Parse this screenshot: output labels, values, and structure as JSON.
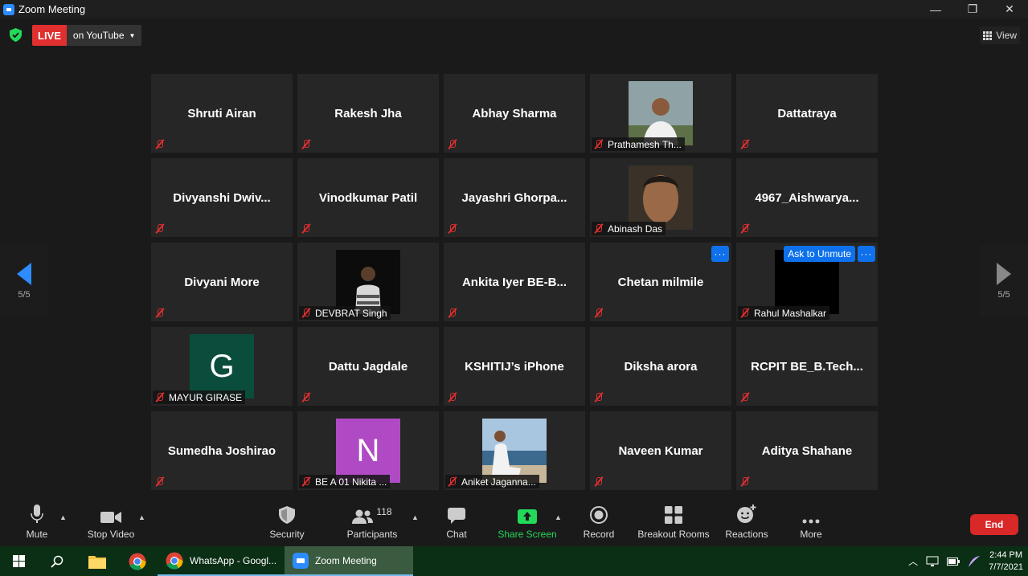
{
  "window": {
    "title": "Zoom Meeting",
    "minimize": "—",
    "restore": "❐",
    "close": "✕"
  },
  "topbar": {
    "live": "LIVE",
    "stream": "on YouTube",
    "view": "View"
  },
  "nav": {
    "page_left": "5/5",
    "page_right": "5/5"
  },
  "tiles": [
    {
      "name": "Shruti Airan",
      "label": "",
      "type": "name"
    },
    {
      "name": "Rakesh Jha",
      "label": "",
      "type": "name"
    },
    {
      "name": "Abhay Sharma",
      "label": "",
      "type": "name"
    },
    {
      "name": "",
      "label": "Prathamesh Th...",
      "type": "photo",
      "photo": "p1"
    },
    {
      "name": "Dattatraya",
      "label": "",
      "type": "name"
    },
    {
      "name": "Divyanshi  Dwiv...",
      "label": "",
      "type": "name"
    },
    {
      "name": "Vinodkumar Patil",
      "label": "",
      "type": "name"
    },
    {
      "name": "Jayashri  Ghorpa...",
      "label": "",
      "type": "name"
    },
    {
      "name": "",
      "label": "Abinash Das",
      "type": "photo",
      "photo": "p2"
    },
    {
      "name": "4967_Aishwarya...",
      "label": "",
      "type": "name"
    },
    {
      "name": "Divyani More",
      "label": "",
      "type": "name"
    },
    {
      "name": "",
      "label": "DEVBRAT Singh",
      "type": "photo",
      "photo": "p3"
    },
    {
      "name": "Ankita  Iyer  BE-B...",
      "label": "",
      "type": "name"
    },
    {
      "name": "Chetan milmile",
      "label": "",
      "type": "name",
      "more": "···"
    },
    {
      "name": "",
      "label": "Rahul Mashalkar",
      "type": "black",
      "more": "···",
      "ask": "Ask to Unmute"
    },
    {
      "name": "",
      "label": "MAYUR GIRASE",
      "type": "letter",
      "letter": "G",
      "color": "#0b4d3c"
    },
    {
      "name": "Dattu Jagdale",
      "label": "",
      "type": "name"
    },
    {
      "name": "KSHITIJ’s iPhone",
      "label": "",
      "type": "name"
    },
    {
      "name": "Diksha arora",
      "label": "",
      "type": "name"
    },
    {
      "name": "RCPIT  BE_B.Tech...",
      "label": "",
      "type": "name"
    },
    {
      "name": "Sumedha Joshirao",
      "label": "",
      "type": "name"
    },
    {
      "name": "",
      "label": "BE A 01 Nikita ...",
      "type": "letter",
      "letter": "N",
      "color": "#b04ac4"
    },
    {
      "name": "",
      "label": "Aniket Jaganna...",
      "type": "photo",
      "photo": "p4"
    },
    {
      "name": "Naveen Kumar",
      "label": "",
      "type": "name"
    },
    {
      "name": "Aditya Shahane",
      "label": "",
      "type": "name"
    }
  ],
  "toolbar": {
    "mute": "Mute",
    "stop_video": "Stop Video",
    "security": "Security",
    "participants": "Participants",
    "participants_count": "118",
    "chat": "Chat",
    "share_screen": "Share Screen",
    "record": "Record",
    "breakout": "Breakout Rooms",
    "reactions": "Reactions",
    "more": "More",
    "end": "End"
  },
  "taskbar": {
    "whatsapp": "WhatsApp - Googl...",
    "zoom": "Zoom Meeting",
    "time": "2:44 PM",
    "date": "7/7/2021"
  },
  "colors": {
    "accent": "#2d8cff",
    "live": "#e02f2f",
    "end": "#d82828",
    "share": "#23d959"
  }
}
